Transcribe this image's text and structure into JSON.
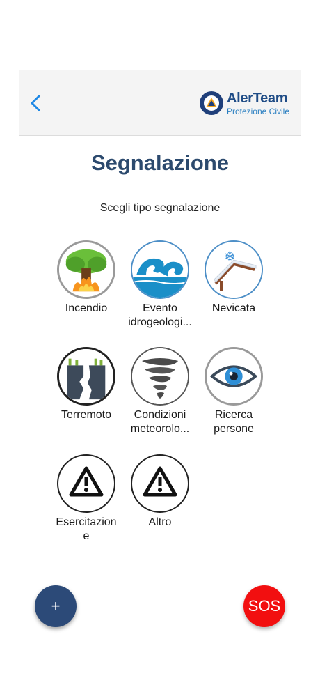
{
  "header": {
    "logo_name": "AlerTeam",
    "logo_subtitle": "Protezione Civile"
  },
  "page": {
    "title": "Segnalazione",
    "subtitle": "Scegli tipo segnalazione"
  },
  "report_types": [
    {
      "label_line1": "Incendio",
      "label_line2": "",
      "icon": "fire-icon"
    },
    {
      "label_line1": "Evento",
      "label_line2": "idrogeologi...",
      "icon": "wave-icon"
    },
    {
      "label_line1": "Nevicata",
      "label_line2": "",
      "icon": "snowfall-icon"
    },
    {
      "label_line1": "Terremoto",
      "label_line2": "",
      "icon": "earthquake-icon"
    },
    {
      "label_line1": "Condizioni",
      "label_line2": "meteorolo...",
      "icon": "tornado-icon"
    },
    {
      "label_line1": "Ricerca",
      "label_line2": "persone",
      "icon": "eye-icon"
    },
    {
      "label_line1": "Esercitazion",
      "label_line2": "e",
      "icon": "warning-icon"
    },
    {
      "label_line1": "Altro",
      "label_line2": "",
      "icon": "warning-icon"
    }
  ],
  "buttons": {
    "add_label": "+",
    "sos_label": "SOS"
  },
  "colors": {
    "title": "#2c4a6e",
    "back_arrow": "#1e88e5",
    "fab_add": "#2c4a78",
    "fab_sos": "#f20f10"
  }
}
